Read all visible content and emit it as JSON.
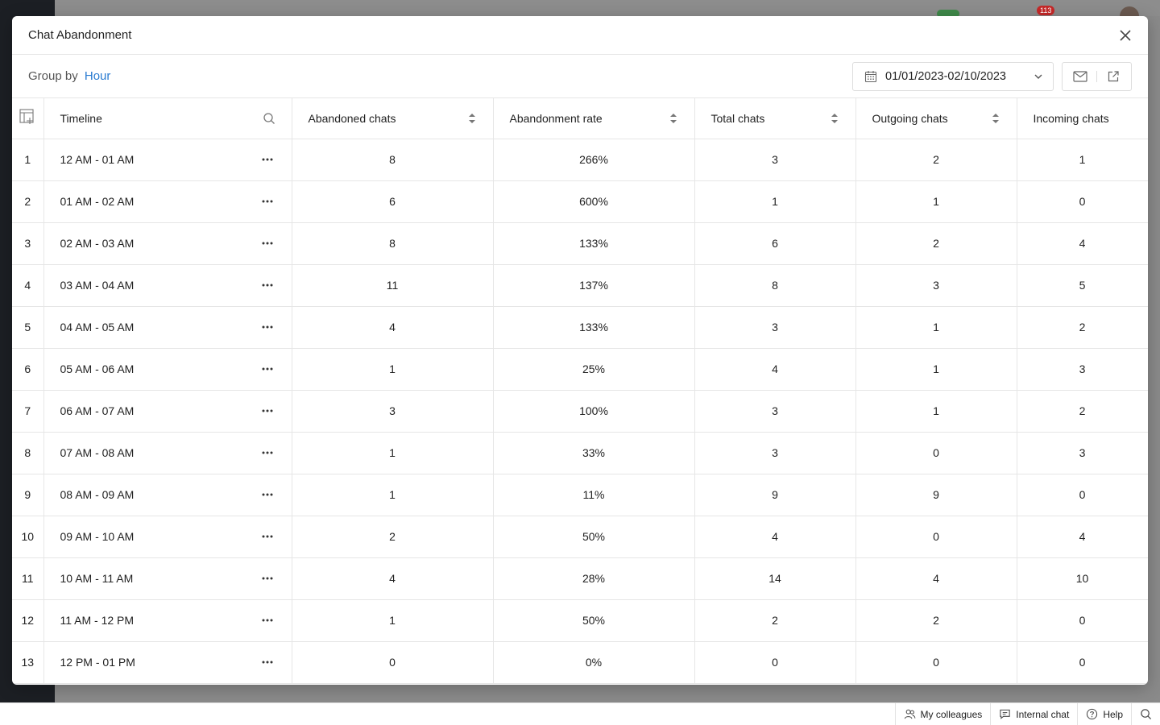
{
  "background": {
    "badge": "113"
  },
  "statusbar": {
    "colleagues": "My colleagues",
    "internal_chat": "Internal chat",
    "help": "Help"
  },
  "modal": {
    "title": "Chat Abandonment",
    "group_by_label": "Group by",
    "group_by_value": "Hour",
    "date_range": "01/01/2023-02/10/2023"
  },
  "table": {
    "columns": [
      "Timeline",
      "Abandoned chats",
      "Abandonment rate",
      "Total chats",
      "Outgoing chats",
      "Incoming chats"
    ],
    "rows": [
      {
        "idx": "1",
        "timeline": "12 AM - 01 AM",
        "abandoned": "8",
        "rate": "266%",
        "total": "3",
        "outgoing": "2",
        "incoming": "1"
      },
      {
        "idx": "2",
        "timeline": "01 AM - 02 AM",
        "abandoned": "6",
        "rate": "600%",
        "total": "1",
        "outgoing": "1",
        "incoming": "0"
      },
      {
        "idx": "3",
        "timeline": "02 AM - 03 AM",
        "abandoned": "8",
        "rate": "133%",
        "total": "6",
        "outgoing": "2",
        "incoming": "4"
      },
      {
        "idx": "4",
        "timeline": "03 AM - 04 AM",
        "abandoned": "11",
        "rate": "137%",
        "total": "8",
        "outgoing": "3",
        "incoming": "5"
      },
      {
        "idx": "5",
        "timeline": "04 AM - 05 AM",
        "abandoned": "4",
        "rate": "133%",
        "total": "3",
        "outgoing": "1",
        "incoming": "2"
      },
      {
        "idx": "6",
        "timeline": "05 AM - 06 AM",
        "abandoned": "1",
        "rate": "25%",
        "total": "4",
        "outgoing": "1",
        "incoming": "3"
      },
      {
        "idx": "7",
        "timeline": "06 AM - 07 AM",
        "abandoned": "3",
        "rate": "100%",
        "total": "3",
        "outgoing": "1",
        "incoming": "2"
      },
      {
        "idx": "8",
        "timeline": "07 AM - 08 AM",
        "abandoned": "1",
        "rate": "33%",
        "total": "3",
        "outgoing": "0",
        "incoming": "3"
      },
      {
        "idx": "9",
        "timeline": "08 AM - 09 AM",
        "abandoned": "1",
        "rate": "11%",
        "total": "9",
        "outgoing": "9",
        "incoming": "0"
      },
      {
        "idx": "10",
        "timeline": "09 AM - 10 AM",
        "abandoned": "2",
        "rate": "50%",
        "total": "4",
        "outgoing": "0",
        "incoming": "4"
      },
      {
        "idx": "11",
        "timeline": "10 AM - 11 AM",
        "abandoned": "4",
        "rate": "28%",
        "total": "14",
        "outgoing": "4",
        "incoming": "10"
      },
      {
        "idx": "12",
        "timeline": "11 AM - 12 PM",
        "abandoned": "1",
        "rate": "50%",
        "total": "2",
        "outgoing": "2",
        "incoming": "0"
      },
      {
        "idx": "13",
        "timeline": "12 PM - 01 PM",
        "abandoned": "0",
        "rate": "0%",
        "total": "0",
        "outgoing": "0",
        "incoming": "0"
      }
    ]
  },
  "colors": {
    "link": "#2a7bd1",
    "border": "#e6e6e6",
    "badge": "#c62828"
  }
}
